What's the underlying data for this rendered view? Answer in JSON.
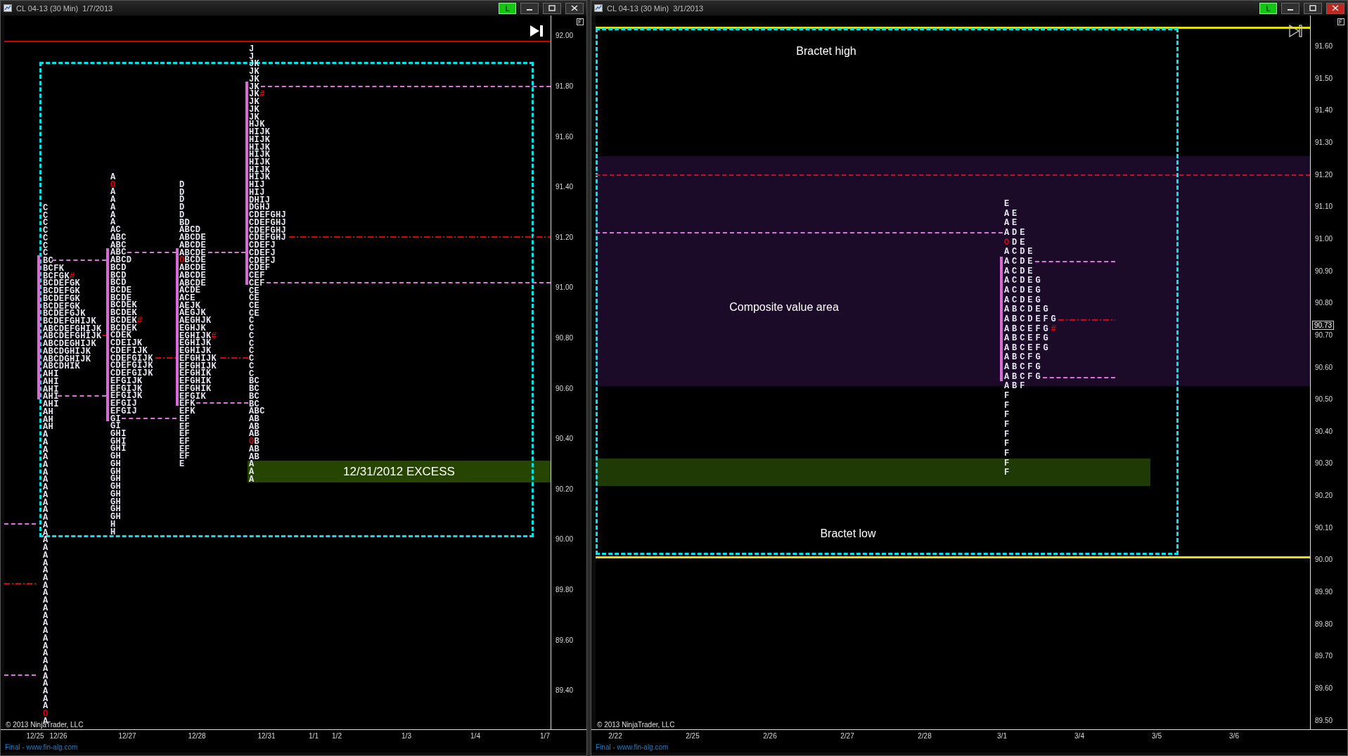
{
  "windows": [
    {
      "title": "CL 04-13 (30 Min)  1/7/2013",
      "status": "L",
      "price_axis": [
        "92.00",
        "91.80",
        "91.60",
        "91.40",
        "91.20",
        "91.00",
        "90.80",
        "90.60",
        "90.40",
        "90.20",
        "90.00",
        "89.80",
        "89.60",
        "89.40"
      ],
      "time_axis": [
        "12/25",
        "12/26",
        "12/27",
        "12/28",
        "12/31",
        "1/1",
        "1/2",
        "1/3",
        "1/4",
        "1/7"
      ],
      "copyright": "© 2013 NinjaTrader, LLC",
      "footer": "Final - www.fin-alg.com",
      "band_label": "12/31/2012 EXCESS",
      "profiles": [
        {
          "rows": [
            "C",
            "C",
            "C",
            "C",
            "C",
            "C",
            "C",
            "BC",
            "BCFK",
            {
              "text": "BCFGK",
              "mark": "#"
            },
            "BCDEFGK",
            "BCDEFGK",
            "BCDEFGK",
            "BCDEFGK",
            "BCDEFGJK",
            "BCDEFGHIJK",
            "ABCDEFGHIJK",
            "ABCDEFGHIJK",
            "ABCDEGHIJK",
            "ABCDGHIJK",
            "ABCDGHIJK",
            "ABCDHIK",
            "AHI",
            "AHI",
            "AHI",
            "AHI",
            "AHI",
            "AH",
            "AH",
            "AH",
            "A",
            "A",
            "A",
            "A",
            "A",
            "A",
            "A",
            "A",
            "A",
            "A",
            "A",
            "A",
            "A",
            "A",
            "A",
            "A",
            "A",
            "A",
            "A",
            "A",
            "A",
            "A",
            "A",
            "A",
            "A",
            "A",
            "A",
            "A",
            "A",
            "A",
            "A",
            "A",
            "A",
            "A",
            "A",
            "A",
            "A",
            {
              "text": "O",
              "open": true
            },
            "A"
          ]
        },
        {
          "rows": [
            "A",
            {
              "text": "O",
              "open": true
            },
            "A",
            "A",
            "A",
            "A",
            "A",
            "AC",
            "ABC",
            "ABC",
            "ABC",
            "ABCD",
            "BCD",
            "BCD",
            "BCD",
            "BCDE",
            "BCDE",
            "BCDEK",
            "BCDEK",
            {
              "text": "BCDEK",
              "mark": "#"
            },
            "BCDEK",
            "CDEK",
            "CDEIJK",
            "CDEFIJK",
            "CDEFGIJK",
            "CDEFGIJK",
            "CDEFGIJK",
            "EFGIJK",
            "EFGIJK",
            "EFGIJK",
            "EFGIJ",
            "EFGIJ",
            "GI",
            "GI",
            "GHI",
            "GHI",
            "GHI",
            "GH",
            "GH",
            "GH",
            "GH",
            "GH",
            "GH",
            "GH",
            "GH",
            "GH",
            "H",
            "H"
          ]
        },
        {
          "rows": [
            "D",
            "D",
            "D",
            "D",
            "D",
            "BD",
            "ABCD",
            "ABCDE",
            "ABCDE",
            "ABCDE",
            {
              "text": "OBCDE",
              "open": true
            },
            "ABCDE",
            "ABCDE",
            "ABCDE",
            "ACDE",
            "ACE",
            "AEJK",
            "AEGJK",
            "AEGHJK",
            "EGHJK",
            {
              "text": "EGHIJK",
              "mark": "#"
            },
            "EGHIJK",
            "EGHIJK",
            "EFGHIJK",
            "EFGHIJK",
            "EFGHIK",
            "EFGHIK",
            "EFGHIK",
            "EFGIK",
            "EFK",
            "EFK",
            "EF",
            "EF",
            "EF",
            "EF",
            "EF",
            "EF",
            "E"
          ]
        },
        {
          "rows": [
            "J",
            "J",
            "JK",
            "JK",
            "JK",
            "JK",
            {
              "text": "JK",
              "mark": "#"
            },
            "JK",
            "JK",
            "JK",
            "HJK",
            "HIJK",
            "HIJK",
            "HIJK",
            "HIJK",
            "HIJK",
            "HIJK",
            "HIJK",
            "HIJ",
            "HIJ",
            "DHIJ",
            "DGHJ",
            "CDEFGHJ",
            "CDEFGHJ",
            "CDEFGHJ",
            "CDEFGHJ",
            "CDEFJ",
            "CDEFJ",
            "CDEFJ",
            "CDEF",
            "CEF",
            "CEF",
            "CE",
            "CE",
            "CE",
            "CE",
            "C",
            "C",
            "C",
            "C",
            "C",
            "C",
            "C",
            "C",
            "BC",
            "BC",
            "BC",
            "BC",
            "ABC",
            "AB",
            "AB",
            "AB",
            {
              "text": "OB",
              "open": true
            },
            "AB",
            "AB",
            "A",
            "A",
            "A"
          ]
        }
      ]
    },
    {
      "title": "CL 04-13 (30 Min)  3/1/2013",
      "status": "L",
      "price_axis": [
        "91.60",
        "91.50",
        "91.40",
        "91.30",
        "91.20",
        "91.10",
        "91.00",
        "90.90",
        "90.80",
        "90.70",
        "90.60",
        "90.50",
        "90.40",
        "90.30",
        "90.20",
        "90.10",
        "90.00",
        "89.90",
        "89.80",
        "89.70",
        "89.60",
        "89.50"
      ],
      "price_marker": "90.73",
      "time_axis": [
        "2/22",
        "2/25",
        "2/26",
        "2/27",
        "2/28",
        "3/1",
        "3/4",
        "3/5",
        "3/6"
      ],
      "copyright": "© 2013 NinjaTrader, LLC",
      "footer": "Final - www.fin-alg.com",
      "annotations": [
        "Bractet high",
        "Composite value area",
        "Bractet low"
      ],
      "profiles": [
        {
          "rows": [
            "E",
            "AE",
            "AE",
            "ADE",
            {
              "text": "ODE",
              "open": true
            },
            "ACDE",
            "ACDE",
            "ACDE",
            "ACDEG",
            "ACDEG",
            "ACDEG",
            "ABCDEG",
            "ABCDEFG",
            {
              "text": "ABCEFG",
              "mark": "#"
            },
            "ABCEFG",
            "ABCEFG",
            "ABCFG",
            "ABCFG",
            "ABCFG",
            "ABF",
            "F",
            "F",
            "F",
            "F",
            "F",
            "F",
            "F",
            "F",
            "F"
          ]
        }
      ]
    }
  ]
}
